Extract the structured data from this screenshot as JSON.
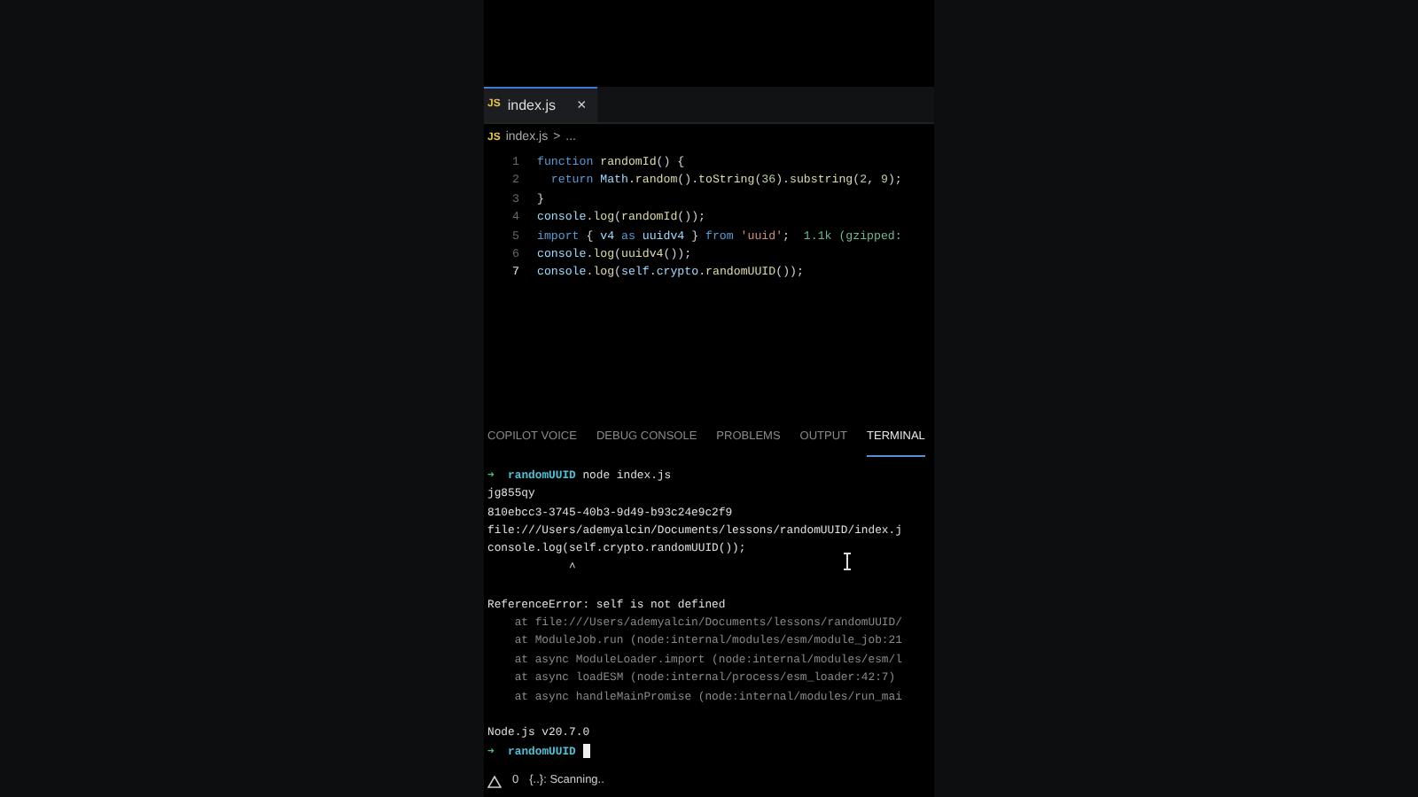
{
  "editor": {
    "tab": {
      "icon_text": "JS",
      "title": "index.js",
      "close": "×",
      "selected": true
    },
    "breadcrumb": {
      "icon_text": "JS",
      "file": "index.js",
      "separator": ">",
      "more": "..."
    },
    "lines": [
      {
        "number": "1",
        "active": false,
        "tokens": [
          {
            "kind": "keyword",
            "text": "function "
          },
          {
            "kind": "fn",
            "text": "randomId"
          },
          {
            "kind": "plain",
            "text": "() {"
          }
        ]
      },
      {
        "number": "2",
        "active": false,
        "tokens": [
          {
            "kind": "keyword",
            "text": "  return "
          },
          {
            "kind": "var",
            "text": "Math"
          },
          {
            "kind": "plain",
            "text": "."
          },
          {
            "kind": "fn",
            "text": "random"
          },
          {
            "kind": "plain",
            "text": "()."
          },
          {
            "kind": "fn",
            "text": "toString"
          },
          {
            "kind": "plain",
            "text": "("
          },
          {
            "kind": "number",
            "text": "36"
          },
          {
            "kind": "plain",
            "text": ")."
          },
          {
            "kind": "fn",
            "text": "substring"
          },
          {
            "kind": "plain",
            "text": "("
          },
          {
            "kind": "number",
            "text": "2"
          },
          {
            "kind": "plain",
            "text": ", "
          },
          {
            "kind": "number",
            "text": "9"
          },
          {
            "kind": "plain",
            "text": ");"
          }
        ]
      },
      {
        "number": "3",
        "active": false,
        "tokens": [
          {
            "kind": "plain",
            "text": "}"
          }
        ]
      },
      {
        "number": "4",
        "active": false,
        "tokens": [
          {
            "kind": "var",
            "text": "console"
          },
          {
            "kind": "plain",
            "text": "."
          },
          {
            "kind": "fn",
            "text": "log"
          },
          {
            "kind": "plain",
            "text": "("
          },
          {
            "kind": "fn",
            "text": "randomId"
          },
          {
            "kind": "plain",
            "text": "());"
          }
        ]
      },
      {
        "number": "5",
        "active": false,
        "tokens": [
          {
            "kind": "keyword",
            "text": "import "
          },
          {
            "kind": "plain",
            "text": "{ "
          },
          {
            "kind": "var",
            "text": "v4"
          },
          {
            "kind": "keyword",
            "text": " as "
          },
          {
            "kind": "var",
            "text": "uuidv4"
          },
          {
            "kind": "plain",
            "text": " } "
          },
          {
            "kind": "keyword",
            "text": "from "
          },
          {
            "kind": "string",
            "text": "'uuid'"
          },
          {
            "kind": "plain",
            "text": ";  "
          },
          {
            "kind": "hint",
            "text": "1.1k (gzipped:"
          }
        ]
      },
      {
        "number": "6",
        "active": false,
        "tokens": [
          {
            "kind": "var",
            "text": "console"
          },
          {
            "kind": "plain",
            "text": "."
          },
          {
            "kind": "fn",
            "text": "log"
          },
          {
            "kind": "plain",
            "text": "("
          },
          {
            "kind": "fn",
            "text": "uuidv4"
          },
          {
            "kind": "plain",
            "text": "());"
          }
        ]
      },
      {
        "number": "7",
        "active": true,
        "tokens": [
          {
            "kind": "var",
            "text": "console"
          },
          {
            "kind": "plain",
            "text": "."
          },
          {
            "kind": "fn",
            "text": "log"
          },
          {
            "kind": "plain",
            "text": "("
          },
          {
            "kind": "var",
            "text": "self"
          },
          {
            "kind": "plain",
            "text": "."
          },
          {
            "kind": "var",
            "text": "crypto"
          },
          {
            "kind": "plain",
            "text": "."
          },
          {
            "kind": "fn",
            "text": "randomUUID"
          },
          {
            "kind": "plain",
            "text": "());"
          }
        ]
      }
    ]
  },
  "panel_tabs": [
    {
      "label": "COPILOT VOICE",
      "selected": false
    },
    {
      "label": "DEBUG CONSOLE",
      "selected": false
    },
    {
      "label": "PROBLEMS",
      "selected": false
    },
    {
      "label": "OUTPUT",
      "selected": false
    },
    {
      "label": "TERMINAL",
      "selected": true
    }
  ],
  "terminal": [
    {
      "kind": "prompt",
      "arrow": "➜",
      "dir": "randomUUID",
      "text": "node index.js"
    },
    {
      "kind": "output",
      "text": "jg855qy"
    },
    {
      "kind": "output",
      "text": "810ebcc3-3745-40b3-9d49-b93c24e9c2f9"
    },
    {
      "kind": "output",
      "text": "file:///Users/ademyalcin/Documents/lessons/randomUUID/index.j"
    },
    {
      "kind": "output",
      "text": "console.log(self.crypto.randomUUID());"
    },
    {
      "kind": "output",
      "text": "            ^"
    },
    {
      "kind": "blank"
    },
    {
      "kind": "output",
      "text": "ReferenceError: self is not defined"
    },
    {
      "kind": "dim",
      "text": "    at file:///Users/ademyalcin/Documents/lessons/randomUUID/"
    },
    {
      "kind": "dim",
      "text": "    at ModuleJob.run (node:internal/modules/esm/module_job:21"
    },
    {
      "kind": "dim",
      "text": "    at async ModuleLoader.import (node:internal/modules/esm/l"
    },
    {
      "kind": "dim",
      "text": "    at async loadESM (node:internal/process/esm_loader:42:7)"
    },
    {
      "kind": "dim",
      "text": "    at async handleMainPromise (node:internal/modules/run_mai"
    },
    {
      "kind": "blank"
    },
    {
      "kind": "output",
      "text": "Node.js v20.7.0"
    },
    {
      "kind": "prompt",
      "arrow": "➜",
      "dir": "randomUUID"
    }
  ],
  "status_bar": {
    "warnings": "0",
    "scan": "{..}: Scanning.."
  }
}
